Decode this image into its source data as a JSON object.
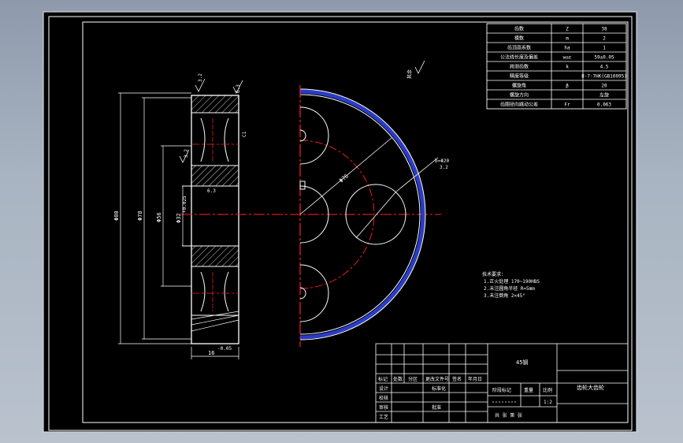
{
  "drawing": {
    "material": "45钢",
    "part_name": "齿轮大齿轮",
    "scale": "1:2",
    "sheet_info": "共 张 第 张"
  },
  "gear_params": [
    {
      "name": "齿数",
      "symbol": "Z",
      "value": "38"
    },
    {
      "name": "模数",
      "symbol": "m",
      "value": "2"
    },
    {
      "name": "齿顶高系数",
      "symbol": "ha",
      "value": "1"
    },
    {
      "name": "公法线长度及偏差",
      "symbol": "w±ε",
      "value": "59±0.05"
    },
    {
      "name": "跨测齿数",
      "symbol": "k",
      "value": "4.5"
    },
    {
      "name": "精度等级",
      "symbol": "",
      "value": "8-7-7HK(GB10095)"
    },
    {
      "name": "螺旋角",
      "symbol": "β",
      "value": "20"
    },
    {
      "name": "螺旋方向",
      "symbol": "",
      "value": "左旋"
    },
    {
      "name": "齿圈径向跳动公差",
      "symbol": "Fr",
      "value": "0.063"
    }
  ],
  "tech_requirements": {
    "title": "技术要求：",
    "items": [
      "1.正火处理 170~190HBS",
      "2.未注圆角半径 R=5mm",
      "3.未注倒角 2×45°"
    ]
  },
  "dimensions": {
    "outer_diameter": "Φ80",
    "tip_diameter": "Φ78",
    "web_diameter": "Φ56",
    "bore": "Φ32",
    "bore_tol": "+0.025",
    "pitch_circle": "Φ76",
    "keyway": "b=Φ20",
    "face_width": "16",
    "face_width_tol": "-0.05"
  },
  "surface_marks": {
    "r1": "3.2",
    "r2": "6.3",
    "chamfer": "C1",
    "other": "其余"
  },
  "title_block": {
    "row_labels": [
      "标记",
      "处数",
      "分区",
      "更改文件号",
      "签名",
      "年月日"
    ],
    "left_labels": [
      "设计",
      "校核",
      "审核",
      "工艺"
    ],
    "std_label": "标准化",
    "approve_label": "批准",
    "stage_labels": [
      "阶段标记",
      "重量",
      "比例"
    ]
  },
  "colors": {
    "screen_bg": "#000000",
    "line": "#ffffff",
    "centerline": "#ff2020",
    "rim": "#2b3bc8",
    "dim": "#ffffff"
  }
}
